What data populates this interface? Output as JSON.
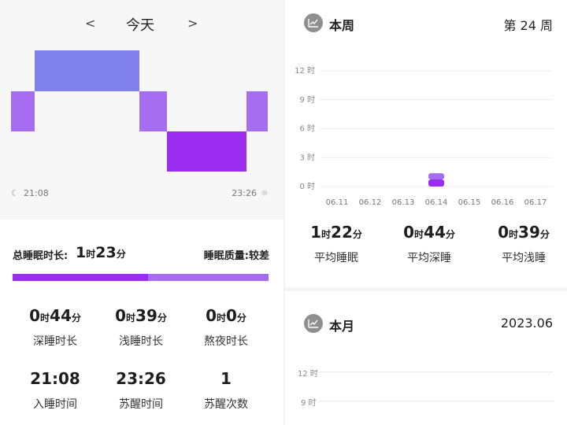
{
  "day": {
    "prev": "<",
    "title": "今天",
    "next": ">",
    "start_time": "21:08",
    "end_time": "23:26",
    "moon_icon": "moon-icon",
    "sun_icon": "sun-icon",
    "colors": {
      "light": "#a66df0",
      "deep": "#9a2df0",
      "awake": "#8181ee"
    }
  },
  "summary": {
    "total_label": "总睡眠时长:",
    "total_hours": "1",
    "hour_unit": "时",
    "total_minutes": "23",
    "minute_unit": "分",
    "quality_label": "睡眠质量:",
    "quality_value": "较差",
    "deep_ratio": 0.53
  },
  "stats": [
    {
      "h": "0",
      "m": "44",
      "label": "深睡时长"
    },
    {
      "h": "0",
      "m": "39",
      "label": "浅睡时长"
    },
    {
      "h": "0",
      "m": "0",
      "label": "熬夜时长"
    }
  ],
  "times": [
    {
      "value": "21:08",
      "label": "入睡时间"
    },
    {
      "value": "23:26",
      "label": "苏醒时间"
    },
    {
      "value": "1",
      "label": "苏醒次数"
    }
  ],
  "week": {
    "title": "本周",
    "right": "第 24 周",
    "y_labels": [
      "12 时",
      "9 时",
      "6 时",
      "3 时",
      "0 时"
    ],
    "x_labels": [
      "06.11",
      "06.12",
      "06.13",
      "06.14",
      "06.15",
      "06.16",
      "06.17"
    ],
    "stats": [
      {
        "h": "1",
        "m": "22",
        "label": "平均睡眠"
      },
      {
        "h": "0",
        "m": "44",
        "label": "平均深睡"
      },
      {
        "h": "0",
        "m": "39",
        "label": "平均浅睡"
      }
    ]
  },
  "month": {
    "title": "本月",
    "right": "2023.06",
    "y_labels": [
      "12 时",
      "9 时"
    ]
  },
  "chart_data": {
    "type": "bar",
    "categories": [
      "06.11",
      "06.12",
      "06.13",
      "06.14",
      "06.15",
      "06.16",
      "06.17"
    ],
    "series": [
      {
        "values": [
          0,
          0,
          0,
          0.73,
          0,
          0,
          0
        ]
      },
      {
        "values": [
          0,
          0,
          0,
          0.65,
          0,
          0,
          0
        ]
      }
    ],
    "ylabel": "",
    "ylim": [
      0,
      12
    ],
    "grid": true
  }
}
